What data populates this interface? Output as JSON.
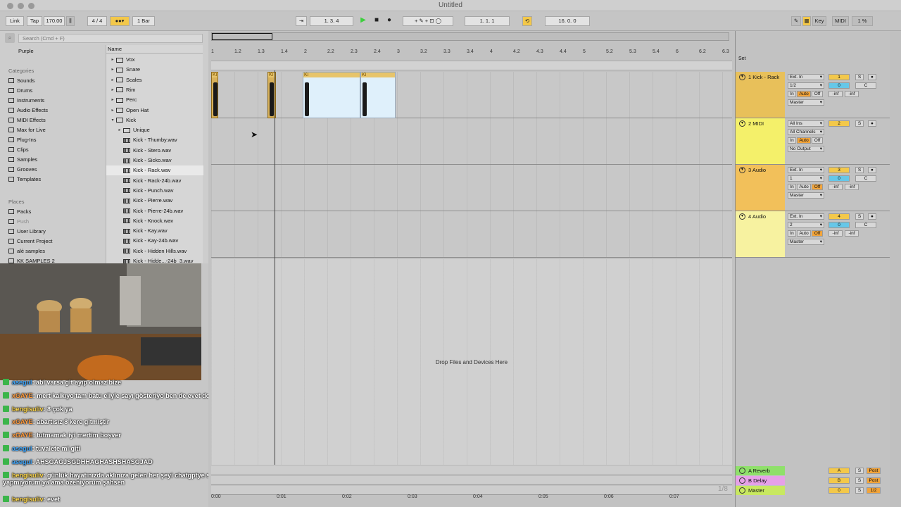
{
  "window": {
    "title": "Untitled"
  },
  "toolbar": {
    "link": "Link",
    "tap": "Tap",
    "tempo": "170.00",
    "signature": "4 / 4",
    "quantize": "1 Bar",
    "position": "1.  3.  4",
    "loop_start": "1.  1.  1",
    "loop_length": "16.  0.  0",
    "key": "Key",
    "midi": "MIDI",
    "cpu": "1 %",
    "h": "H",
    "w": "W"
  },
  "browser": {
    "search_placeholder": "Search (Cmd + F)",
    "collection_first": "Purple",
    "categories_title": "Categories",
    "categories": [
      "Sounds",
      "Drums",
      "Instruments",
      "Audio Effects",
      "MIDI Effects",
      "Max for Live",
      "Plug-Ins",
      "Clips",
      "Samples",
      "Grooves",
      "Templates"
    ],
    "places_title": "Places",
    "places": [
      "Packs",
      "Push",
      "User Library",
      "Current Project",
      "alé samples",
      "KK SAMPLES 2"
    ],
    "files_header": "Name",
    "files": [
      "Vox",
      "Snare",
      "Scales",
      "Rim",
      "Perc",
      "Open Hat",
      "Kick",
      "Unique",
      "Kick - Thumby.wav",
      "Kick - Stero.wav",
      "Kick - Sicko.wav",
      "Kick - Rack.wav",
      "Kick - Rack-24b.wav",
      "Kick - Punch.wav",
      "Kick - Pierre.wav",
      "Kick - Pierre-24b.wav",
      "Kick - Knock.wav",
      "Kick - Kay.wav",
      "Kick - Kay-24b.wav",
      "Kick - Hidden Hills.wav",
      "Kick - Hidde...-24b_3.wav"
    ]
  },
  "arrangement": {
    "ruler": [
      "1",
      "1.2",
      "1.3",
      "1.4",
      "2",
      "2.2",
      "2.3",
      "2.4",
      "3",
      "3.2",
      "3.3",
      "3.4",
      "4",
      "4.2",
      "4.3",
      "4.4",
      "5",
      "5.2",
      "5.3",
      "5.4",
      "6",
      "6.2",
      "6.3"
    ],
    "clip_label": "Ki",
    "drop_text": "Drop Files and Devices Here",
    "time_labels": [
      "0:00",
      "0:01",
      "0:02",
      "0:03",
      "0:04",
      "0:05",
      "0:06",
      "0:07"
    ],
    "zoom_count": "1/8"
  },
  "mixer": {
    "set_label": "Set",
    "tracks": [
      {
        "name": "1 Kick - Rack",
        "input": "Ext. In",
        "channel": "1/2",
        "output": "Master",
        "number": "1",
        "volume": "0",
        "pan": "C",
        "peak1": "-inf",
        "peak2": "-inf"
      },
      {
        "name": "2 MIDI",
        "input": "All Ins",
        "channel": "All Channels",
        "output": "No Output",
        "number": "2",
        "volume": "",
        "pan": "",
        "peak1": "",
        "peak2": ""
      },
      {
        "name": "3 Audio",
        "input": "Ext. In",
        "channel": "1",
        "output": "Master",
        "number": "3",
        "volume": "0",
        "pan": "C",
        "peak1": "-inf",
        "peak2": "-inf"
      },
      {
        "name": "4 Audio",
        "input": "Ext. In",
        "channel": "2",
        "output": "Master",
        "number": "4",
        "volume": "0",
        "pan": "C",
        "peak1": "-inf",
        "peak2": "-inf"
      }
    ],
    "monitor_in": "In",
    "monitor_auto": "Auto",
    "monitor_off": "Off",
    "solo": "S",
    "returns": [
      {
        "name": "A Reverb",
        "letter": "A",
        "post": "Post"
      },
      {
        "name": "B Delay",
        "letter": "B",
        "post": "Post"
      },
      {
        "name": "Master",
        "letter": "0",
        "post": "1/2"
      }
    ]
  },
  "chat": [
    {
      "user": "asegul",
      "text": ": abi varsa git ayıp olmaz bize"
    },
    {
      "user": "xGAYE",
      "text": ": mert kalkıyo tam batu eliyle sayı gösteriyo ben de evet doğru diyorum"
    },
    {
      "user": "bengisuliv",
      "text": ": 8 çok ya"
    },
    {
      "user": "xGAYE",
      "text": ": abartısız 8 kere gitmiştir"
    },
    {
      "user": "xGAYE",
      "text": ": tutmamak iyi mertim boşver"
    },
    {
      "user": "asegul",
      "text": ": tuvalete mi giti"
    },
    {
      "user": "asegul",
      "text": ": AHSGAGJSGDHHAGHASHSHASGJAD"
    },
    {
      "user": "bengisuliv",
      "text": ": günlük hayatınızda aklınıza gelen her şeyi chatgptye soruyor musunuz ben hiç yapmıyorum ya ama özeniyorum şahsen"
    },
    {
      "user": "bengisuliv",
      "text": ": evet"
    }
  ],
  "colors": {
    "track1": "#e8c05a",
    "track2": "#f4f06a",
    "track3": "#f2c05a",
    "track4": "#f7f2a0",
    "reverb": "#8fe06a",
    "delay": "#e6a0e8",
    "master": "#c8e860"
  }
}
